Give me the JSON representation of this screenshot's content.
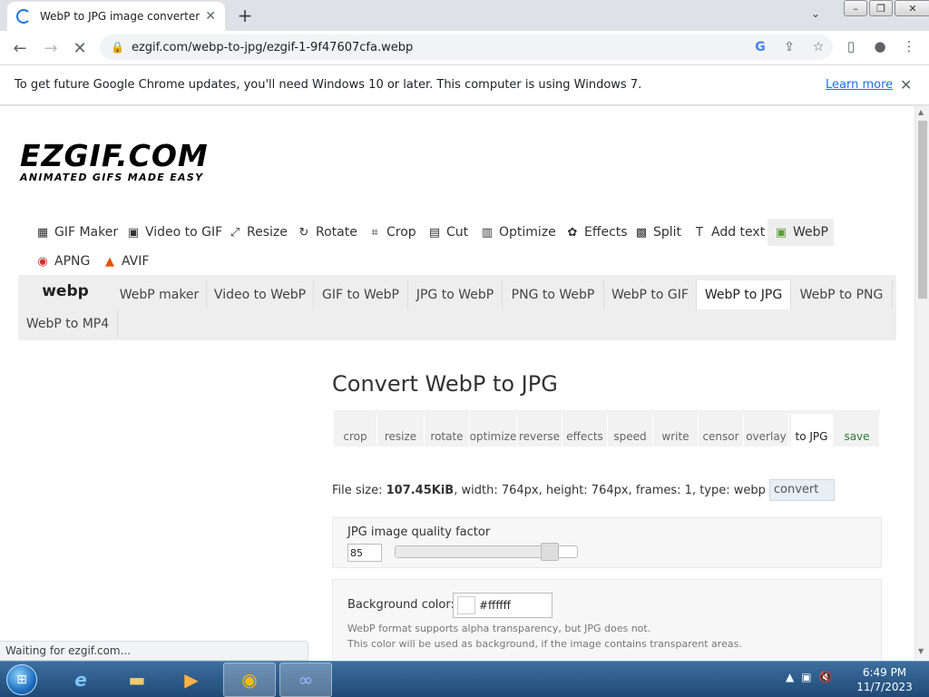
{
  "browser": {
    "tab_title": "WebP to JPG image converter - A",
    "new_tab": "+",
    "url": "ezgif.com/webp-to-jpg/ezgif-1-9f47607cfa.webp",
    "infobar_message": "To get future Google Chrome updates, you'll need Windows 10 or later. This computer is using Windows 7.",
    "infobar_link": "Learn more",
    "status": "Waiting for ezgif.com..."
  },
  "logo": {
    "main": "EZGIF.COM",
    "tagline": "ANIMATED GIFS MADE EASY"
  },
  "main_nav": [
    {
      "label": "GIF Maker",
      "icon": "gif-maker-icon"
    },
    {
      "label": "Video to GIF",
      "icon": "film-icon"
    },
    {
      "label": "Resize",
      "icon": "resize-icon"
    },
    {
      "label": "Rotate",
      "icon": "rotate-icon"
    },
    {
      "label": "Crop",
      "icon": "crop-icon"
    },
    {
      "label": "Cut",
      "icon": "cut-icon"
    },
    {
      "label": "Optimize",
      "icon": "optimize-icon"
    },
    {
      "label": "Effects",
      "icon": "palette-icon"
    },
    {
      "label": "Split",
      "icon": "split-icon"
    },
    {
      "label": "Add text",
      "icon": "text-icon"
    },
    {
      "label": "WebP",
      "icon": "webp-icon"
    },
    {
      "label": "APNG",
      "icon": "apng-icon"
    },
    {
      "label": "AVIF",
      "icon": "avif-icon"
    }
  ],
  "sub_nav": {
    "brand": "webp",
    "items": [
      "WebP maker",
      "Video to WebP",
      "GIF to WebP",
      "JPG to WebP",
      "PNG to WebP",
      "WebP to GIF",
      "WebP to JPG",
      "WebP to PNG",
      "WebP to MP4"
    ]
  },
  "page_title": "Convert WebP to JPG",
  "tools": [
    "crop",
    "resize",
    "rotate",
    "optimize",
    "reverse",
    "effects",
    "speed",
    "write",
    "censor",
    "overlay",
    "to JPG",
    "save"
  ],
  "file_info": {
    "prefix": "File size: ",
    "size": "107.45KiB",
    "rest": ", width: 764px, height: 764px, frames: 1, type: webp",
    "button": "convert"
  },
  "quality": {
    "label": "JPG image quality factor",
    "value": "85",
    "fraction": 0.85
  },
  "background": {
    "label": "Background color:",
    "value": "#ffffff",
    "note1": "WebP format supports alpha transparency, but JPG does not.",
    "note2": "This color will be used as background, if the image contains transparent areas."
  },
  "clock": {
    "time": "6:49 PM",
    "date": "11/7/2023"
  }
}
